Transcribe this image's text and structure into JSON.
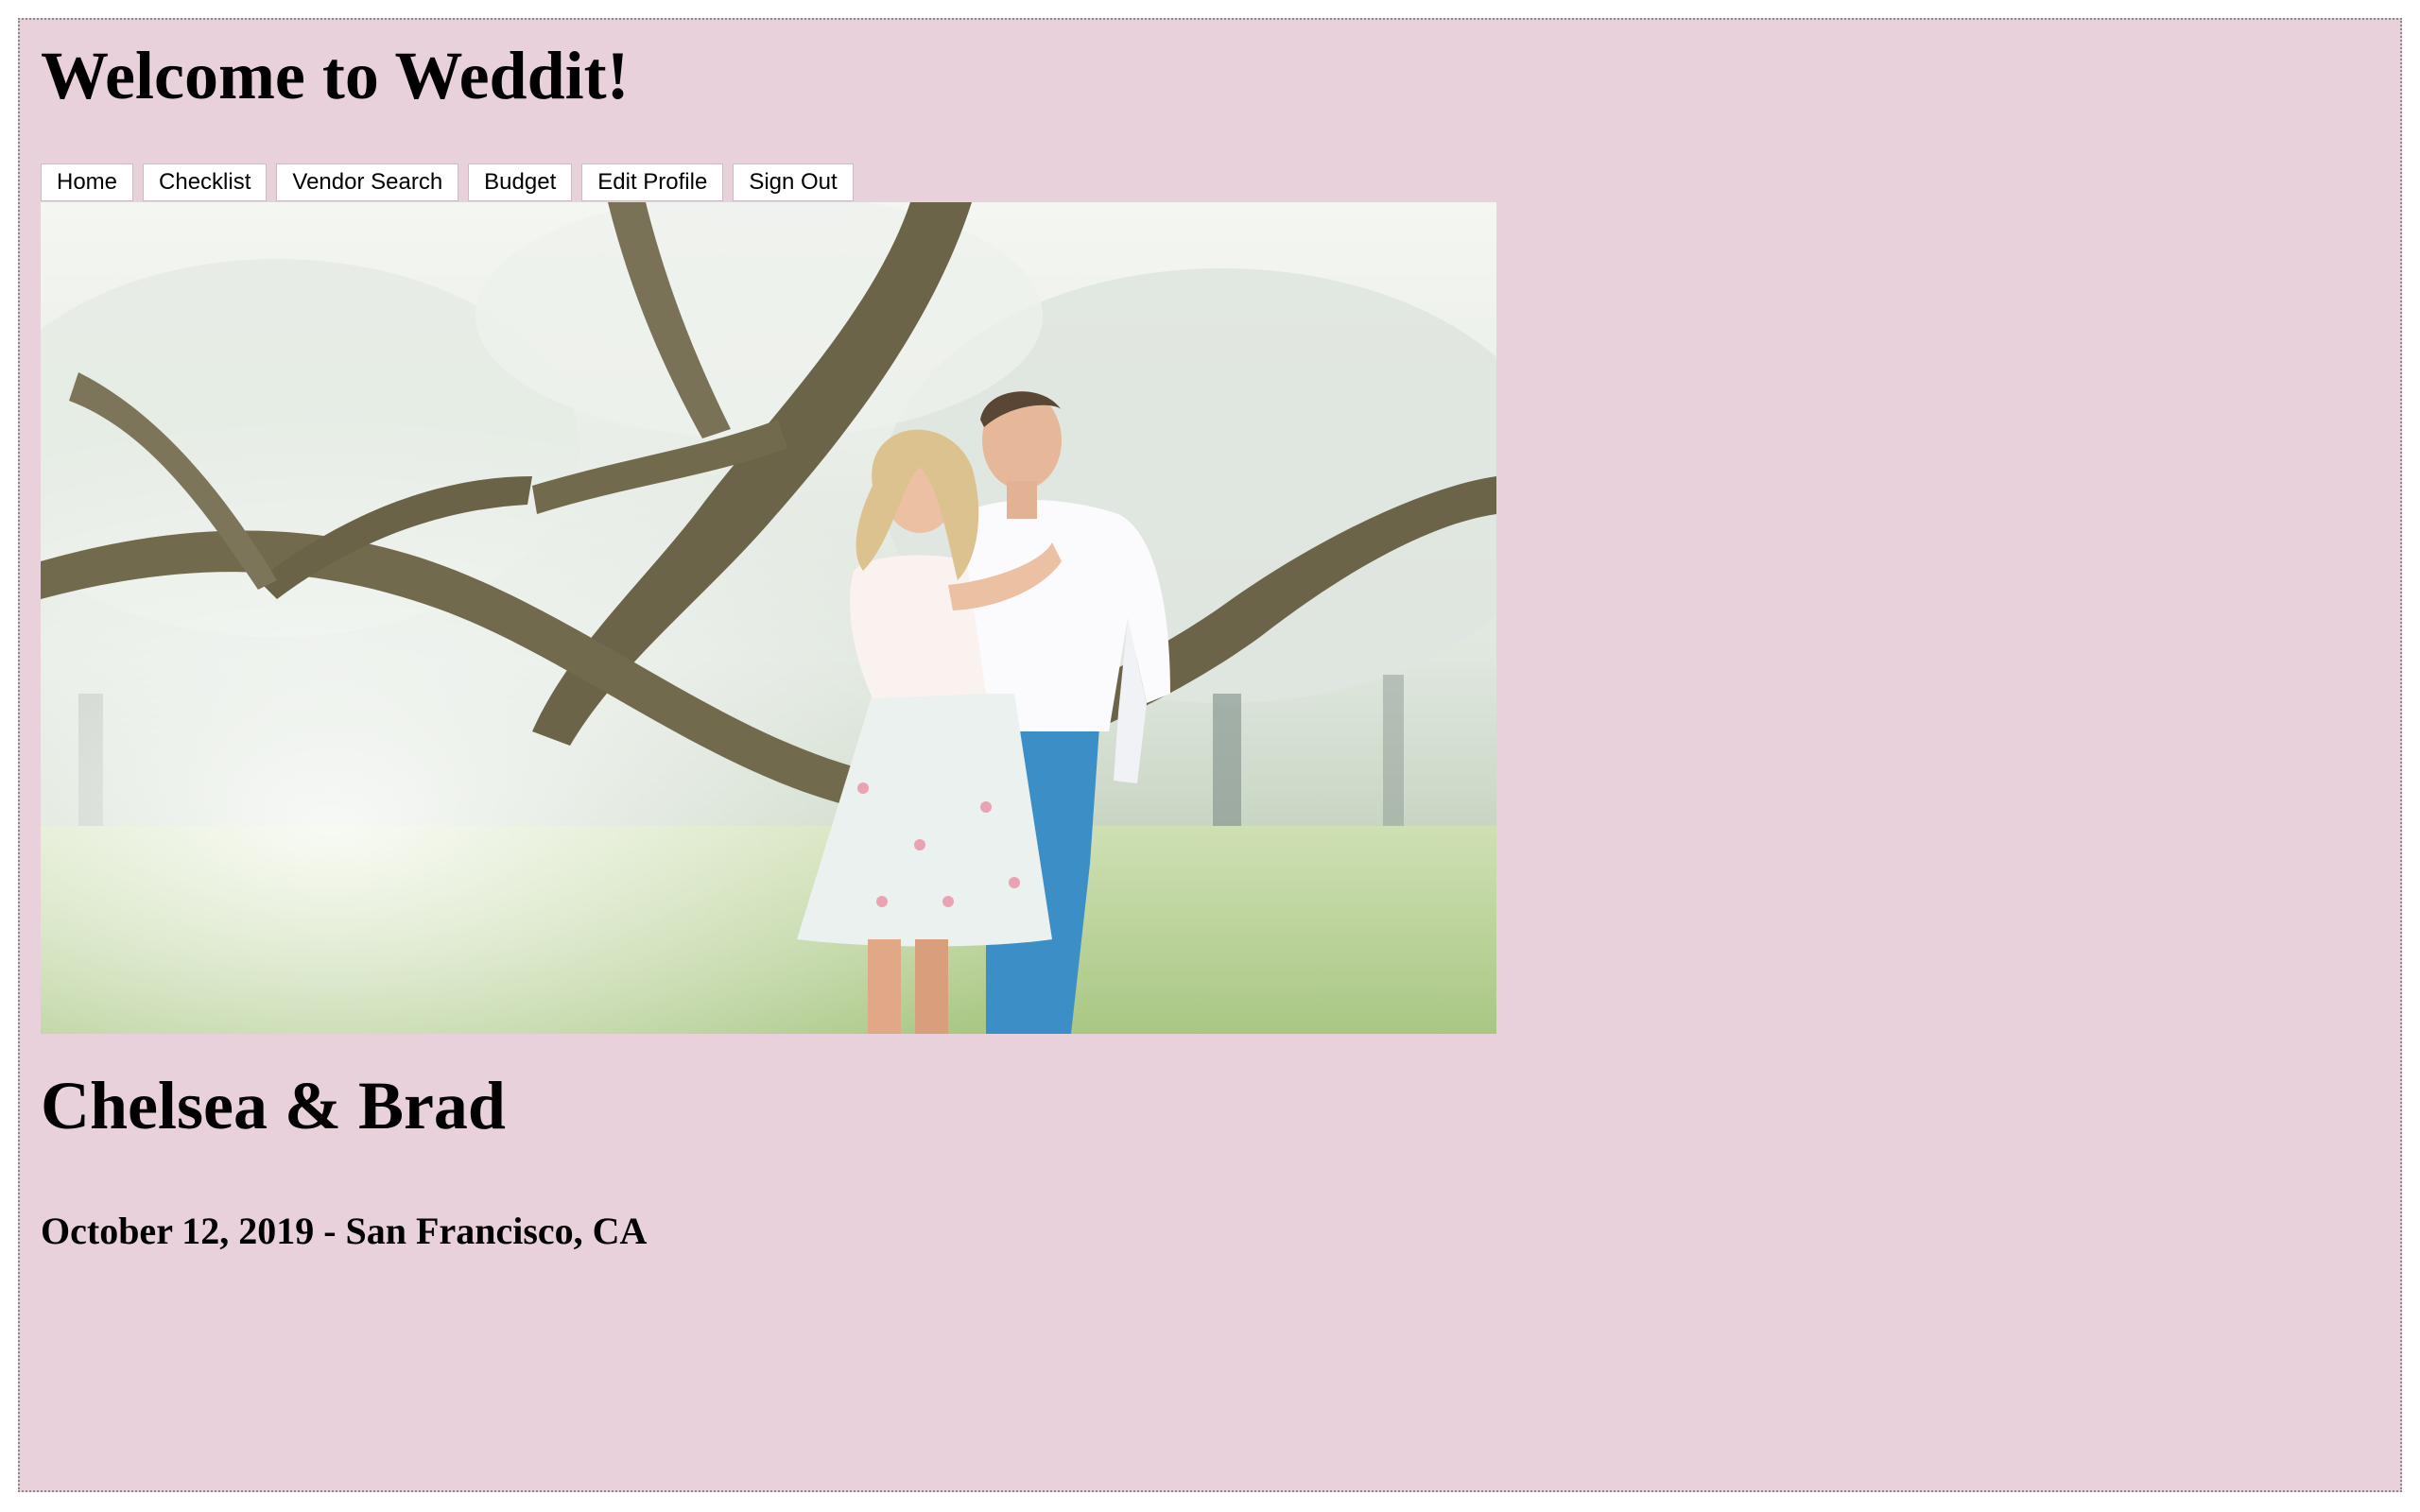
{
  "header": {
    "title": "Welcome to Weddit!"
  },
  "nav": {
    "items": [
      {
        "label": "Home"
      },
      {
        "label": "Checklist"
      },
      {
        "label": "Vendor Search"
      },
      {
        "label": "Budget"
      },
      {
        "label": "Edit Profile"
      },
      {
        "label": "Sign Out"
      }
    ]
  },
  "profile": {
    "photo_subject": "engagement photo of couple under large oak tree",
    "couple_names": "Chelsea & Brad",
    "wedding_info": "October 12, 2019 - San Francisco, CA"
  },
  "colors": {
    "page_background": "#e8d1db",
    "button_background": "#ffffff",
    "text": "#000000"
  }
}
